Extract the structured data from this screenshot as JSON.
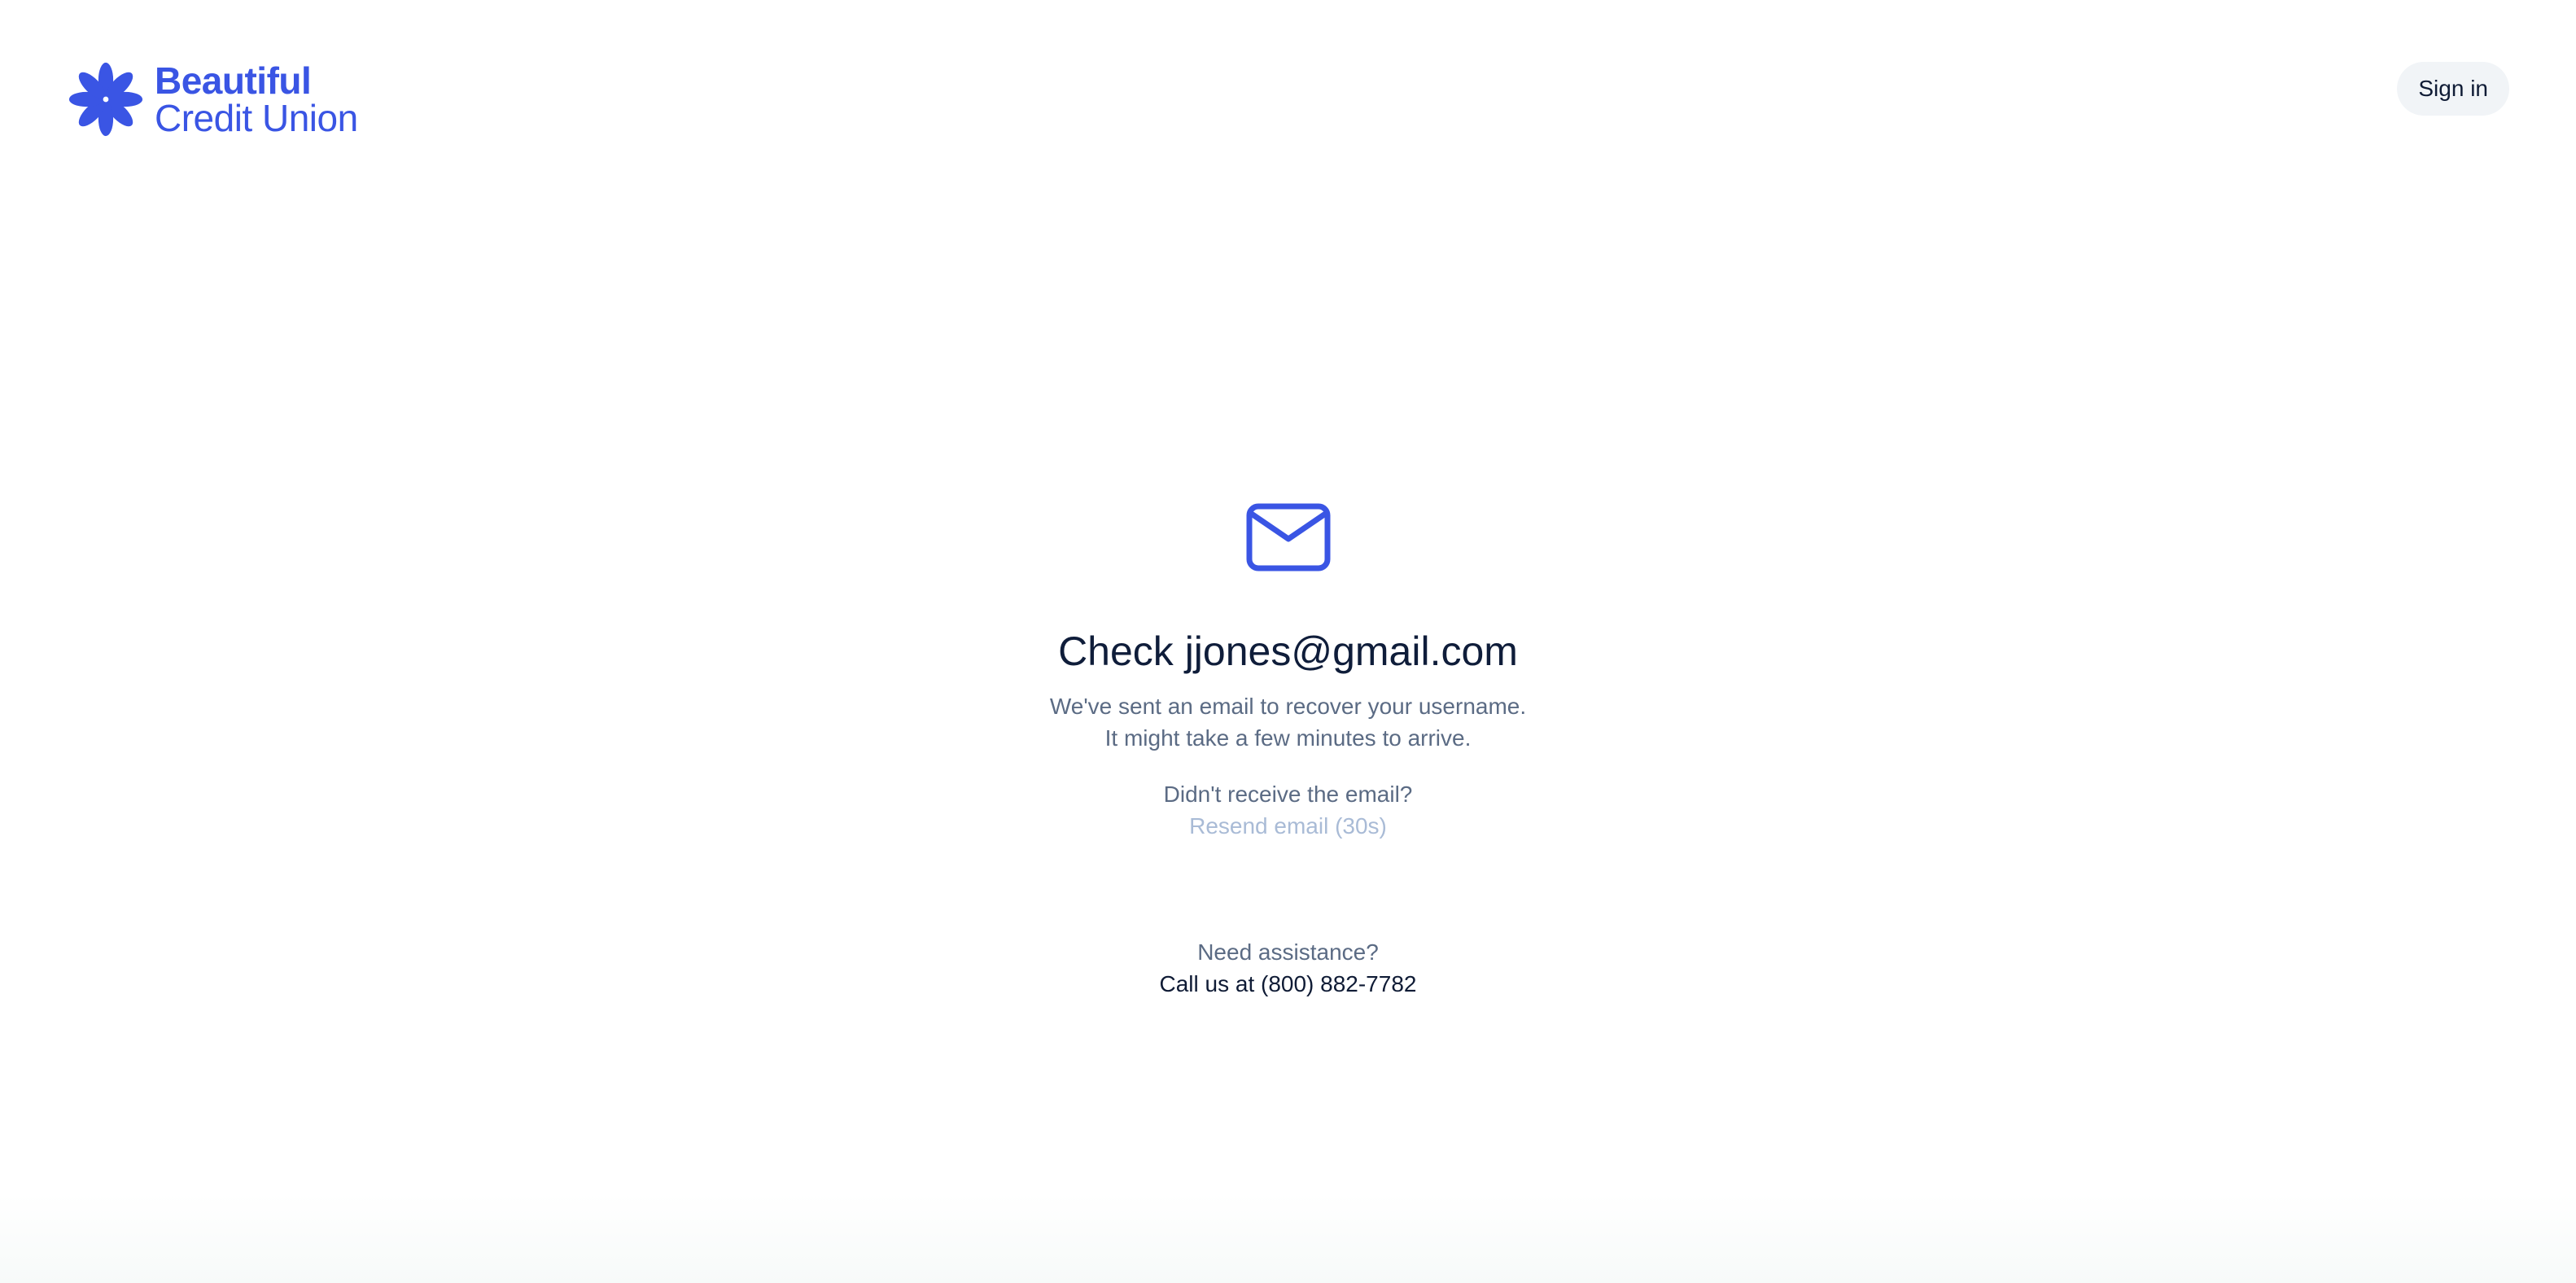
{
  "header": {
    "brand_line1": "Beautiful",
    "brand_line2": "Credit Union",
    "signin_label": "Sign in"
  },
  "main": {
    "icon": "mail-icon",
    "title": "Check jjones@gmail.com",
    "description_line1": "We've sent an email to recover your username.",
    "description_line2": "It might take a few minutes to arrive.",
    "resend_prompt": "Didn't receive the email?",
    "resend_link": "Resend email (30s)",
    "assist_prompt": "Need assistance?",
    "assist_call": "Call us at (800) 882-7782"
  },
  "colors": {
    "brand": "#3a55e4",
    "heading": "#0f1d3a",
    "body_text": "#5b6b84",
    "disabled_link": "#a9bbd6",
    "signin_bg": "#f1f4f7"
  }
}
